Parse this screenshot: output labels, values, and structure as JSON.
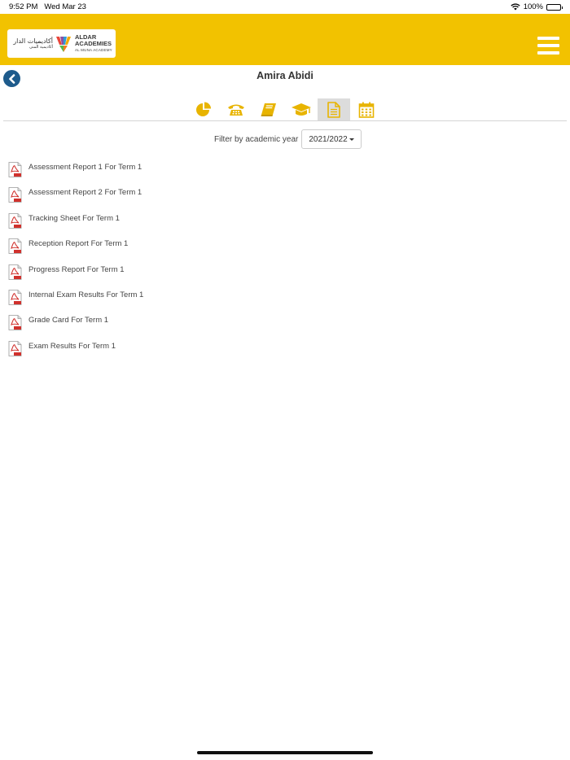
{
  "status_bar": {
    "time": "9:52 PM",
    "date": "Wed Mar 23",
    "battery": "100%"
  },
  "logo": {
    "arabic_title": "أكاديميات الدار",
    "arabic_sub": "أكاديمية المنى",
    "english_title_1": "ALDAR",
    "english_title_2": "ACADEMIES",
    "english_sub": "AL MUNA ACADEMY"
  },
  "student": {
    "name": "Amira Abidi"
  },
  "tabs": [
    {
      "icon": "pie-chart-icon",
      "active": false
    },
    {
      "icon": "telephone-icon",
      "active": false
    },
    {
      "icon": "book-icon",
      "active": false
    },
    {
      "icon": "graduation-cap-icon",
      "active": false
    },
    {
      "icon": "document-icon",
      "active": true
    },
    {
      "icon": "calendar-icon",
      "active": false
    }
  ],
  "filter": {
    "label": "Filter by academic year",
    "selected_year": "2021/2022"
  },
  "reports": [
    {
      "label": "Assessment Report 1 For Term 1"
    },
    {
      "label": "Assessment Report 2 For Term 1"
    },
    {
      "label": "Tracking Sheet For Term 1"
    },
    {
      "label": "Reception Report For Term 1"
    },
    {
      "label": "Progress Report For Term 1"
    },
    {
      "label": "Internal Exam Results For Term 1"
    },
    {
      "label": "Grade Card For Term 1"
    },
    {
      "label": "Exam Results For Term 1"
    }
  ],
  "colors": {
    "header": "#f2c200",
    "icon": "#e8b400",
    "back_button": "#1e5b8c",
    "pdf_red": "#d0312d"
  }
}
